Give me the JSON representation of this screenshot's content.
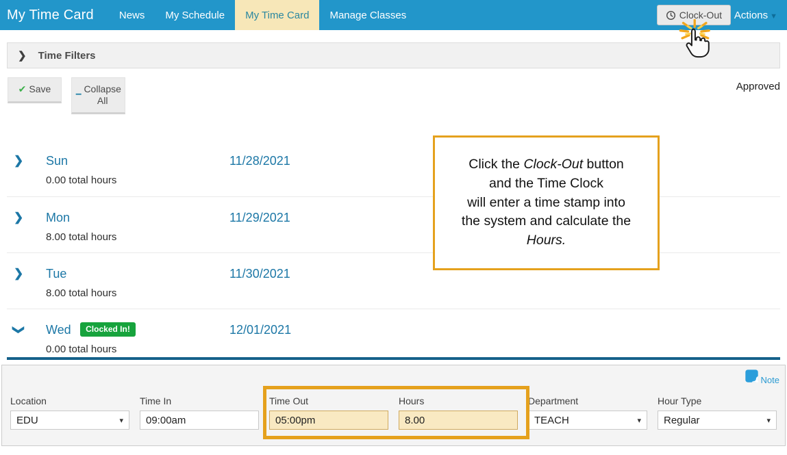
{
  "nav": {
    "brand": "My Time Card",
    "tabs": [
      {
        "label": "News",
        "active": false
      },
      {
        "label": "My Schedule",
        "active": false
      },
      {
        "label": "My Time Card",
        "active": true
      },
      {
        "label": "Manage Classes",
        "active": false
      }
    ],
    "clock_out_label": "Clock-Out",
    "actions_label": "Actions"
  },
  "filters": {
    "title": "Time Filters"
  },
  "toolbar": {
    "save_label": "Save",
    "collapse_all_label": "Collapse All",
    "status": "Approved"
  },
  "days": [
    {
      "day": "Sun",
      "date": "11/28/2021",
      "total": "0.00 total hours",
      "badge": "",
      "expanded": false
    },
    {
      "day": "Mon",
      "date": "11/29/2021",
      "total": "8.00 total hours",
      "badge": "",
      "expanded": false
    },
    {
      "day": "Tue",
      "date": "11/30/2021",
      "total": "8.00 total hours",
      "badge": "",
      "expanded": false
    },
    {
      "day": "Wed",
      "date": "12/01/2021",
      "total": "0.00 total hours",
      "badge": "Clocked In!",
      "expanded": true
    }
  ],
  "callout": {
    "line1_pre": "Click the ",
    "line1_italic": "Clock-Out",
    "line1_post": " button",
    "line2": "and the Time Clock",
    "line3": "will enter a time stamp into",
    "line4": "the system and calculate the",
    "line5_italic": "Hours."
  },
  "entry": {
    "note_label": "Note",
    "fields": [
      {
        "label": "Location",
        "value": "EDU",
        "type": "select",
        "highlight": false
      },
      {
        "label": "Time In",
        "value": "09:00am",
        "type": "input",
        "highlight": false
      },
      {
        "label": "Time Out",
        "value": "05:00pm",
        "type": "input",
        "highlight": true
      },
      {
        "label": "Hours",
        "value": "8.00",
        "type": "input",
        "highlight": true
      },
      {
        "label": "Department",
        "value": "TEACH",
        "type": "select",
        "highlight": false
      },
      {
        "label": "Hour Type",
        "value": "Regular",
        "type": "select",
        "highlight": false
      }
    ]
  },
  "colors": {
    "nav_blue": "#2296ca",
    "active_tab_bg": "#f7e7b8",
    "active_tab_fg": "#2a87a0",
    "link_blue": "#1c77a6",
    "badge_green": "#17a33d",
    "check_green": "#3db04b",
    "collapse_teal": "#1a7fa6",
    "line_teal": "#15618a",
    "highlight_orange": "#e5a11d",
    "tan_bg": "#f9e9c2",
    "note_blue": "#2a9ad2"
  }
}
